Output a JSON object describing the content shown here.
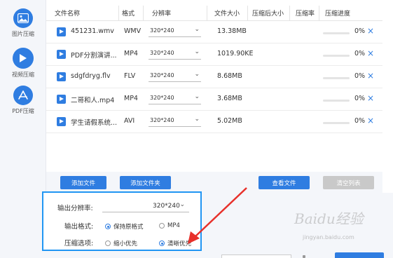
{
  "sidebar": {
    "items": [
      {
        "label": "图片压缩",
        "icon": "image-icon"
      },
      {
        "label": "视频压缩",
        "icon": "play-icon"
      },
      {
        "label": "PDF压缩",
        "icon": "pdf-icon"
      }
    ]
  },
  "table": {
    "headers": [
      "文件名称",
      "格式",
      "分辨率",
      "文件大小",
      "压缩后大小",
      "压缩率",
      "压缩进度"
    ],
    "rows": [
      {
        "name": "451231.wmv",
        "format": "WMV",
        "resolution": "320*240",
        "size": "13.38MB",
        "progress": "0%"
      },
      {
        "name": "PDF分割演讲...",
        "format": "MP4",
        "resolution": "320*240",
        "size": "1019.90KE",
        "progress": "0%"
      },
      {
        "name": "sdgfdryg.flv",
        "format": "FLV",
        "resolution": "320*240",
        "size": "8.68MB",
        "progress": "0%"
      },
      {
        "name": "二哥和人.mp4",
        "format": "MP4",
        "resolution": "320*240",
        "size": "3.68MB",
        "progress": "0%"
      },
      {
        "name": "学生请假系统...",
        "format": "AVI",
        "resolution": "320*240",
        "size": "5.02MB",
        "progress": "0%"
      }
    ]
  },
  "buttons": {
    "add_file": "添加文件",
    "add_folder": "添加文件夹",
    "view_file": "查看文件",
    "clear_list": "清空列表"
  },
  "options": {
    "resolution_label": "输出分辨率:",
    "resolution_value": "320*240",
    "format_label": "输出格式:",
    "format_options": [
      "保持原格式",
      "MP4"
    ],
    "compress_label": "压缩选项:",
    "compress_options": [
      "缩小优先",
      "清晰优先"
    ]
  },
  "watermark": {
    "text": "Baidu经验",
    "url": "jingyan.baidu.com"
  },
  "colors": {
    "accent": "#2f7de1",
    "highlight_border": "#2196f3",
    "arrow": "#e8302a"
  }
}
